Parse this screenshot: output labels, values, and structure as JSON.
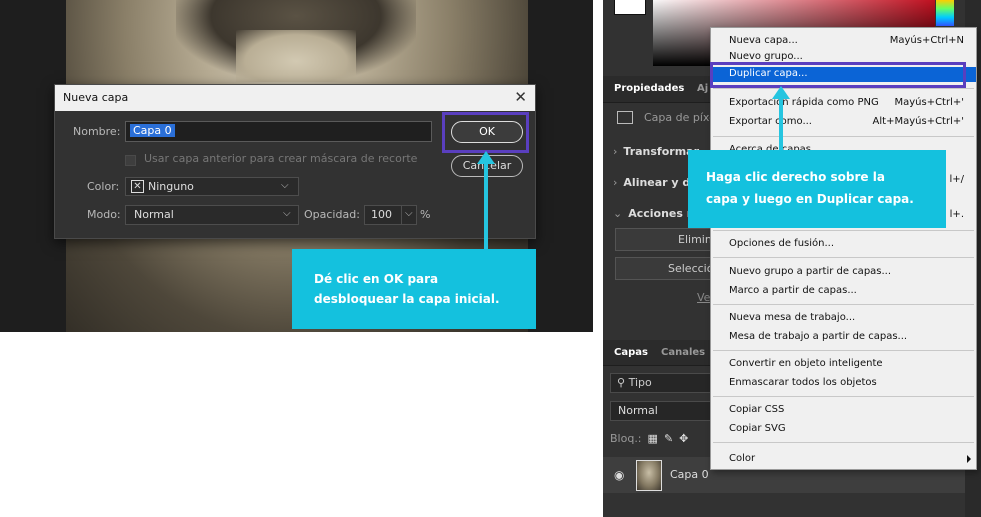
{
  "dialog": {
    "title": "Nueva capa",
    "name_label": "Nombre:",
    "name_value": "Capa 0",
    "clip_label": "Usar capa anterior para crear máscara de recorte",
    "color_label": "Color:",
    "color_value": "Ninguno",
    "mode_label": "Modo:",
    "mode_value": "Normal",
    "opacity_label": "Opacidad:",
    "opacity_value": "100",
    "percent": "%",
    "ok_label": "OK",
    "cancel_label": "Cancelar",
    "close_glyph": "✕",
    "x_glyph": "✕"
  },
  "callouts": {
    "left": [
      "Dé clic en OK para",
      "desbloquear la capa inicial."
    ],
    "right": [
      "Haga clic derecho sobre la",
      "capa y luego en Duplicar capa."
    ],
    "color": "#14c1de",
    "highlight_color": "#5a3fbf"
  },
  "properties_panel": {
    "tabs": [
      "Propiedades",
      "Aj"
    ],
    "layer_type": "Capa de píxe",
    "sections": [
      "Transformar",
      "Alinear y d",
      "Acciones r"
    ],
    "buttons": [
      "Elimin",
      "Selecció"
    ],
    "link": "Ve"
  },
  "layers_panel": {
    "tabs": [
      "Capas",
      "Canales"
    ],
    "filter": "Tipo",
    "blend": "Normal",
    "lock_label": "Bloq.:",
    "layer_name": "Capa 0"
  },
  "context_menu": {
    "items": [
      {
        "label": "Nueva capa...",
        "shortcut": "Mayús+Ctrl+N"
      },
      {
        "label": "Nuevo grupo...",
        "shortcut": ""
      },
      {
        "label": "Duplicar capa...",
        "shortcut": "",
        "selected": true
      },
      {
        "label": "Exportación rápida como PNG",
        "shortcut": "Mayús+Ctrl+'"
      },
      {
        "label": "Exportar como...",
        "shortcut": "Alt+Mayús+Ctrl+'"
      },
      {
        "label": "Acerca de capas",
        "shortcut": ""
      },
      {
        "label": "",
        "shortcut": "l+/"
      },
      {
        "label": "",
        "shortcut": "l+."
      },
      {
        "label": "Opciones de fusión...",
        "shortcut": ""
      },
      {
        "label": "Nuevo grupo a partir de capas...",
        "shortcut": ""
      },
      {
        "label": "Marco a partir de capas...",
        "shortcut": ""
      },
      {
        "label": "Nueva mesa de trabajo...",
        "shortcut": ""
      },
      {
        "label": "Mesa de trabajo a partir de capas...",
        "shortcut": ""
      },
      {
        "label": "Convertir en objeto inteligente",
        "shortcut": ""
      },
      {
        "label": "Enmascarar todos los objetos",
        "shortcut": ""
      },
      {
        "label": "Copiar CSS",
        "shortcut": ""
      },
      {
        "label": "Copiar SVG",
        "shortcut": ""
      },
      {
        "label": "Color",
        "shortcut": "",
        "submenu": true
      }
    ]
  }
}
